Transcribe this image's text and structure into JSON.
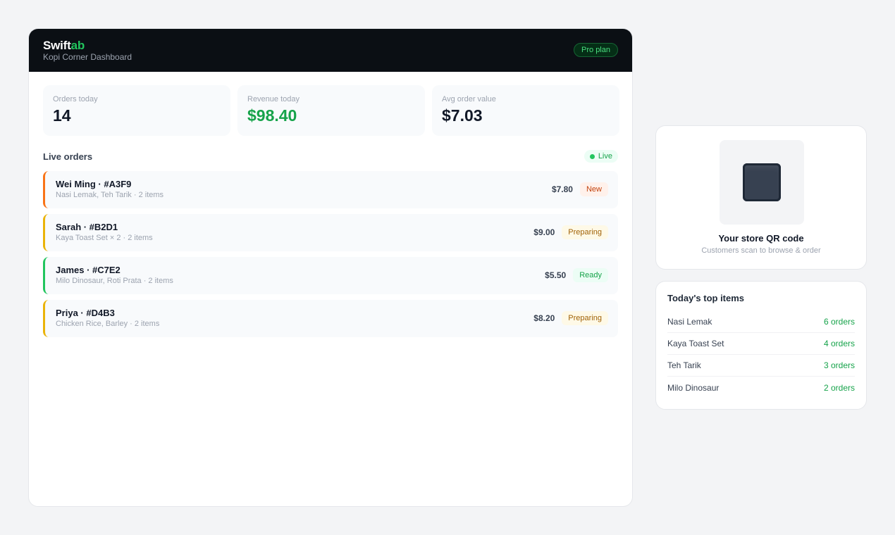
{
  "header": {
    "brand_main": "Swift",
    "brand_accent": "ab",
    "store_name": "Kopi Corner Dashboard",
    "plan": "Pro plan"
  },
  "stats": [
    {
      "label": "Orders today",
      "value": "14"
    },
    {
      "label": "Revenue today",
      "value": "$98.40"
    },
    {
      "label": "Avg order value",
      "value": "$7.03"
    }
  ],
  "orders_section": {
    "title": "Live orders",
    "live_label": "Live"
  },
  "orders": [
    {
      "name": "Wei Ming · #A3F9",
      "items": "Nasi Lemak, Teh Tarik · 2 items",
      "price": "$7.80",
      "status": "New",
      "accent": "#f97316"
    },
    {
      "name": "Sarah · #B2D1",
      "items": "Kaya Toast Set × 2 · 2 items",
      "price": "$9.00",
      "status": "Preparing",
      "accent": "#eab308"
    },
    {
      "name": "James · #C7E2",
      "items": "Milo Dinosaur, Roti Prata · 2 items",
      "price": "$5.50",
      "status": "Ready",
      "accent": "#22c55e"
    },
    {
      "name": "Priya · #D4B3",
      "items": "Chicken Rice, Barley · 2 items",
      "price": "$8.20",
      "status": "Preparing",
      "accent": "#eab308"
    }
  ],
  "qr": {
    "icon": "qr-code-icon",
    "title": "Your store QR code",
    "subtitle": "Customers scan to browse & order"
  },
  "top_items": {
    "title": "Today's top items",
    "items": [
      {
        "name": "Nasi Lemak",
        "count": "6 orders"
      },
      {
        "name": "Kaya Toast Set",
        "count": "4 orders"
      },
      {
        "name": "Teh Tarik",
        "count": "3 orders"
      },
      {
        "name": "Milo Dinosaur",
        "count": "2 orders"
      }
    ]
  }
}
